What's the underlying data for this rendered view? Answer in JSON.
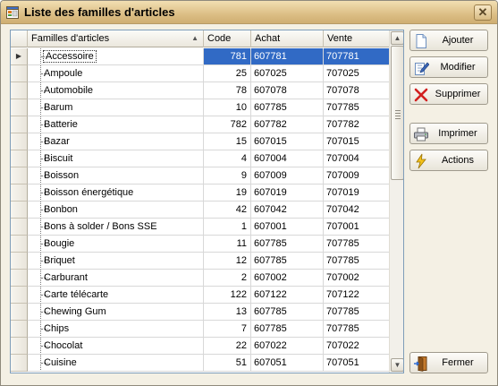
{
  "window": {
    "title": "Liste des familles d'articles",
    "close_glyph": "✕"
  },
  "grid": {
    "columns": [
      "Familles d'articles",
      "Code",
      "Achat",
      "Vente"
    ],
    "sort_indicator": "▲",
    "current_row_marker": "▶",
    "rows": [
      {
        "name": "Accessoire",
        "code": "781",
        "achat": "607781",
        "vente": "707781"
      },
      {
        "name": "Ampoule",
        "code": "25",
        "achat": "607025",
        "vente": "707025"
      },
      {
        "name": "Automobile",
        "code": "78",
        "achat": "607078",
        "vente": "707078"
      },
      {
        "name": "Barum",
        "code": "10",
        "achat": "607785",
        "vente": "707785"
      },
      {
        "name": "Batterie",
        "code": "782",
        "achat": "607782",
        "vente": "707782"
      },
      {
        "name": "Bazar",
        "code": "15",
        "achat": "607015",
        "vente": "707015"
      },
      {
        "name": "Biscuit",
        "code": "4",
        "achat": "607004",
        "vente": "707004"
      },
      {
        "name": "Boisson",
        "code": "9",
        "achat": "607009",
        "vente": "707009"
      },
      {
        "name": "Boisson énergétique",
        "code": "19",
        "achat": "607019",
        "vente": "707019"
      },
      {
        "name": "Bonbon",
        "code": "42",
        "achat": "607042",
        "vente": "707042"
      },
      {
        "name": "Bons à solder / Bons SSE",
        "code": "1",
        "achat": "607001",
        "vente": "707001"
      },
      {
        "name": "Bougie",
        "code": "11",
        "achat": "607785",
        "vente": "707785"
      },
      {
        "name": "Briquet",
        "code": "12",
        "achat": "607785",
        "vente": "707785"
      },
      {
        "name": "Carburant",
        "code": "2",
        "achat": "607002",
        "vente": "707002"
      },
      {
        "name": "Carte télécarte",
        "code": "122",
        "achat": "607122",
        "vente": "707122"
      },
      {
        "name": "Chewing Gum",
        "code": "13",
        "achat": "607785",
        "vente": "707785"
      },
      {
        "name": "Chips",
        "code": "7",
        "achat": "607785",
        "vente": "707785"
      },
      {
        "name": "Chocolat",
        "code": "22",
        "achat": "607022",
        "vente": "707022"
      },
      {
        "name": "Cuisine",
        "code": "51",
        "achat": "607051",
        "vente": "707051"
      }
    ]
  },
  "scrollbar": {
    "up_glyph": "▲",
    "down_glyph": "▼"
  },
  "buttons": {
    "ajouter": "Ajouter",
    "modifier": "Modifier",
    "supprimer": "Supprimer",
    "imprimer": "Imprimer",
    "actions": "Actions",
    "fermer": "Fermer"
  },
  "colors": {
    "selection": "#316ac5",
    "titlebar": "#dcbe85",
    "window_bg": "#f4f0e4"
  }
}
